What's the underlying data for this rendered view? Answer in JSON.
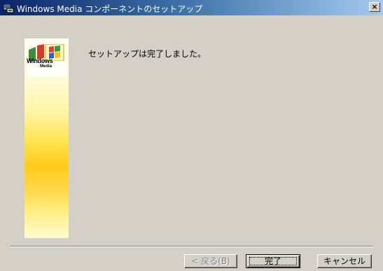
{
  "window": {
    "title": "Windows Media コンポーネントのセットアップ",
    "close_label": "×"
  },
  "logo": {
    "line1": "Windows",
    "line2": "Media"
  },
  "content": {
    "message": "セットアップは完了しました。"
  },
  "buttons": {
    "back": "< 戻る(B)",
    "finish": "完了",
    "cancel": "キャンセル"
  },
  "colors": {
    "title_bar_start": "#0a246a",
    "title_bar_end": "#a6caf0",
    "dialog_background": "#d4d0c8",
    "side_panel_accent": "#ffcc1a"
  }
}
